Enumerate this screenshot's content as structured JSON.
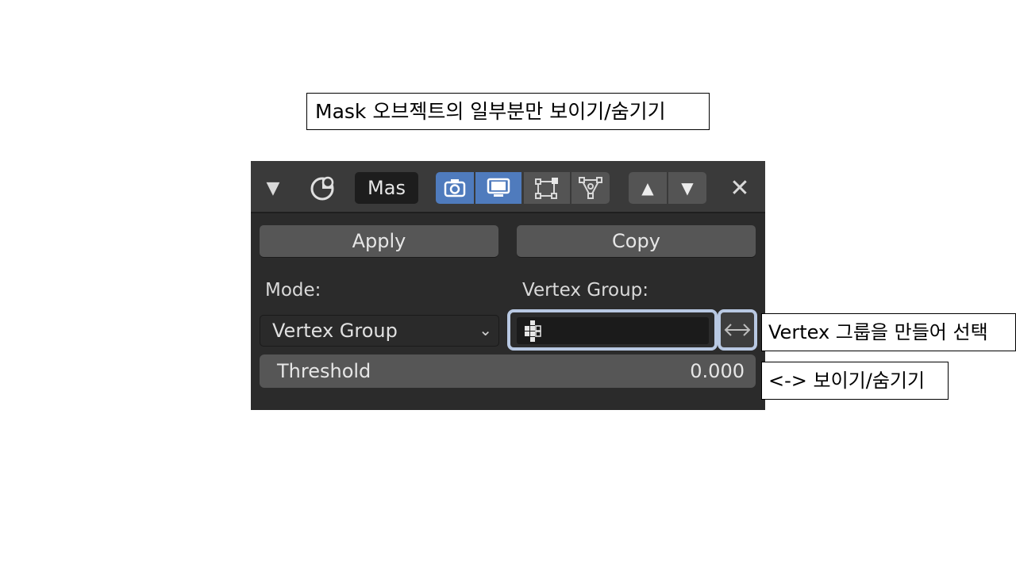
{
  "annotations": {
    "title": "Mask 오브젝트의 일부분만 보이기/숨기기",
    "vertex_group_note": "Vertex 그룹을 만들어 선택",
    "invert_note": "<-> 보이기/숨기기"
  },
  "panel": {
    "header": {
      "collapse_glyph": "▼",
      "modifier_name": "Mas",
      "toggles": [
        {
          "icon": "camera-icon",
          "active": true
        },
        {
          "icon": "monitor-icon",
          "active": true
        },
        {
          "icon": "edit-mode-icon",
          "active": false
        },
        {
          "icon": "vertex-triangle-icon",
          "active": false
        }
      ],
      "move_up_glyph": "▲",
      "move_down_glyph": "▼",
      "close_glyph": "✕"
    },
    "apply_label": "Apply",
    "copy_label": "Copy",
    "mode_label": "Mode:",
    "mode_value": "Vertex Group",
    "vertex_group_label": "Vertex Group:",
    "vertex_group_value": "",
    "threshold": {
      "label": "Threshold",
      "value": "0.000"
    }
  },
  "colors": {
    "accent": "#4f7bbd",
    "highlight_border": "#b8c8e2",
    "panel_bg": "#2b2b2b"
  }
}
